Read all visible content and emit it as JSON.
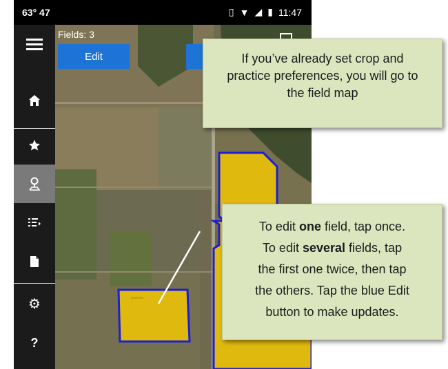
{
  "status": {
    "left_text": "63° 47",
    "time": "11:47"
  },
  "map": {
    "fields_label": "Fields: 3",
    "edit_label": "Edit"
  },
  "sidebar": {
    "items": [
      {
        "icon": "menu-icon"
      },
      {
        "icon": "home-icon"
      },
      {
        "icon": "star-icon"
      },
      {
        "icon": "map-pin-icon",
        "active": true
      },
      {
        "icon": "list-icon"
      },
      {
        "icon": "document-icon"
      },
      {
        "icon": "gear-icon"
      },
      {
        "icon": "help-icon"
      }
    ]
  },
  "callouts": {
    "top": "If you’ve already set crop and practice preferences, you will go to the field map",
    "bottom": {
      "l1_a": "To edit ",
      "l1_b": "one",
      "l1_c": " field, tap once.",
      "l2_a": "To edit ",
      "l2_b": "several",
      "l2_c": " fields, tap",
      "l3": "the first one twice, then tap",
      "l4": "the others. Tap the blue Edit",
      "l5": "button to make updates."
    }
  },
  "colors": {
    "field_fill": "#e0b90f",
    "field_border": "#1a1ed8",
    "button_blue": "#1e73d6",
    "callout_bg": "#dbe6bf"
  }
}
